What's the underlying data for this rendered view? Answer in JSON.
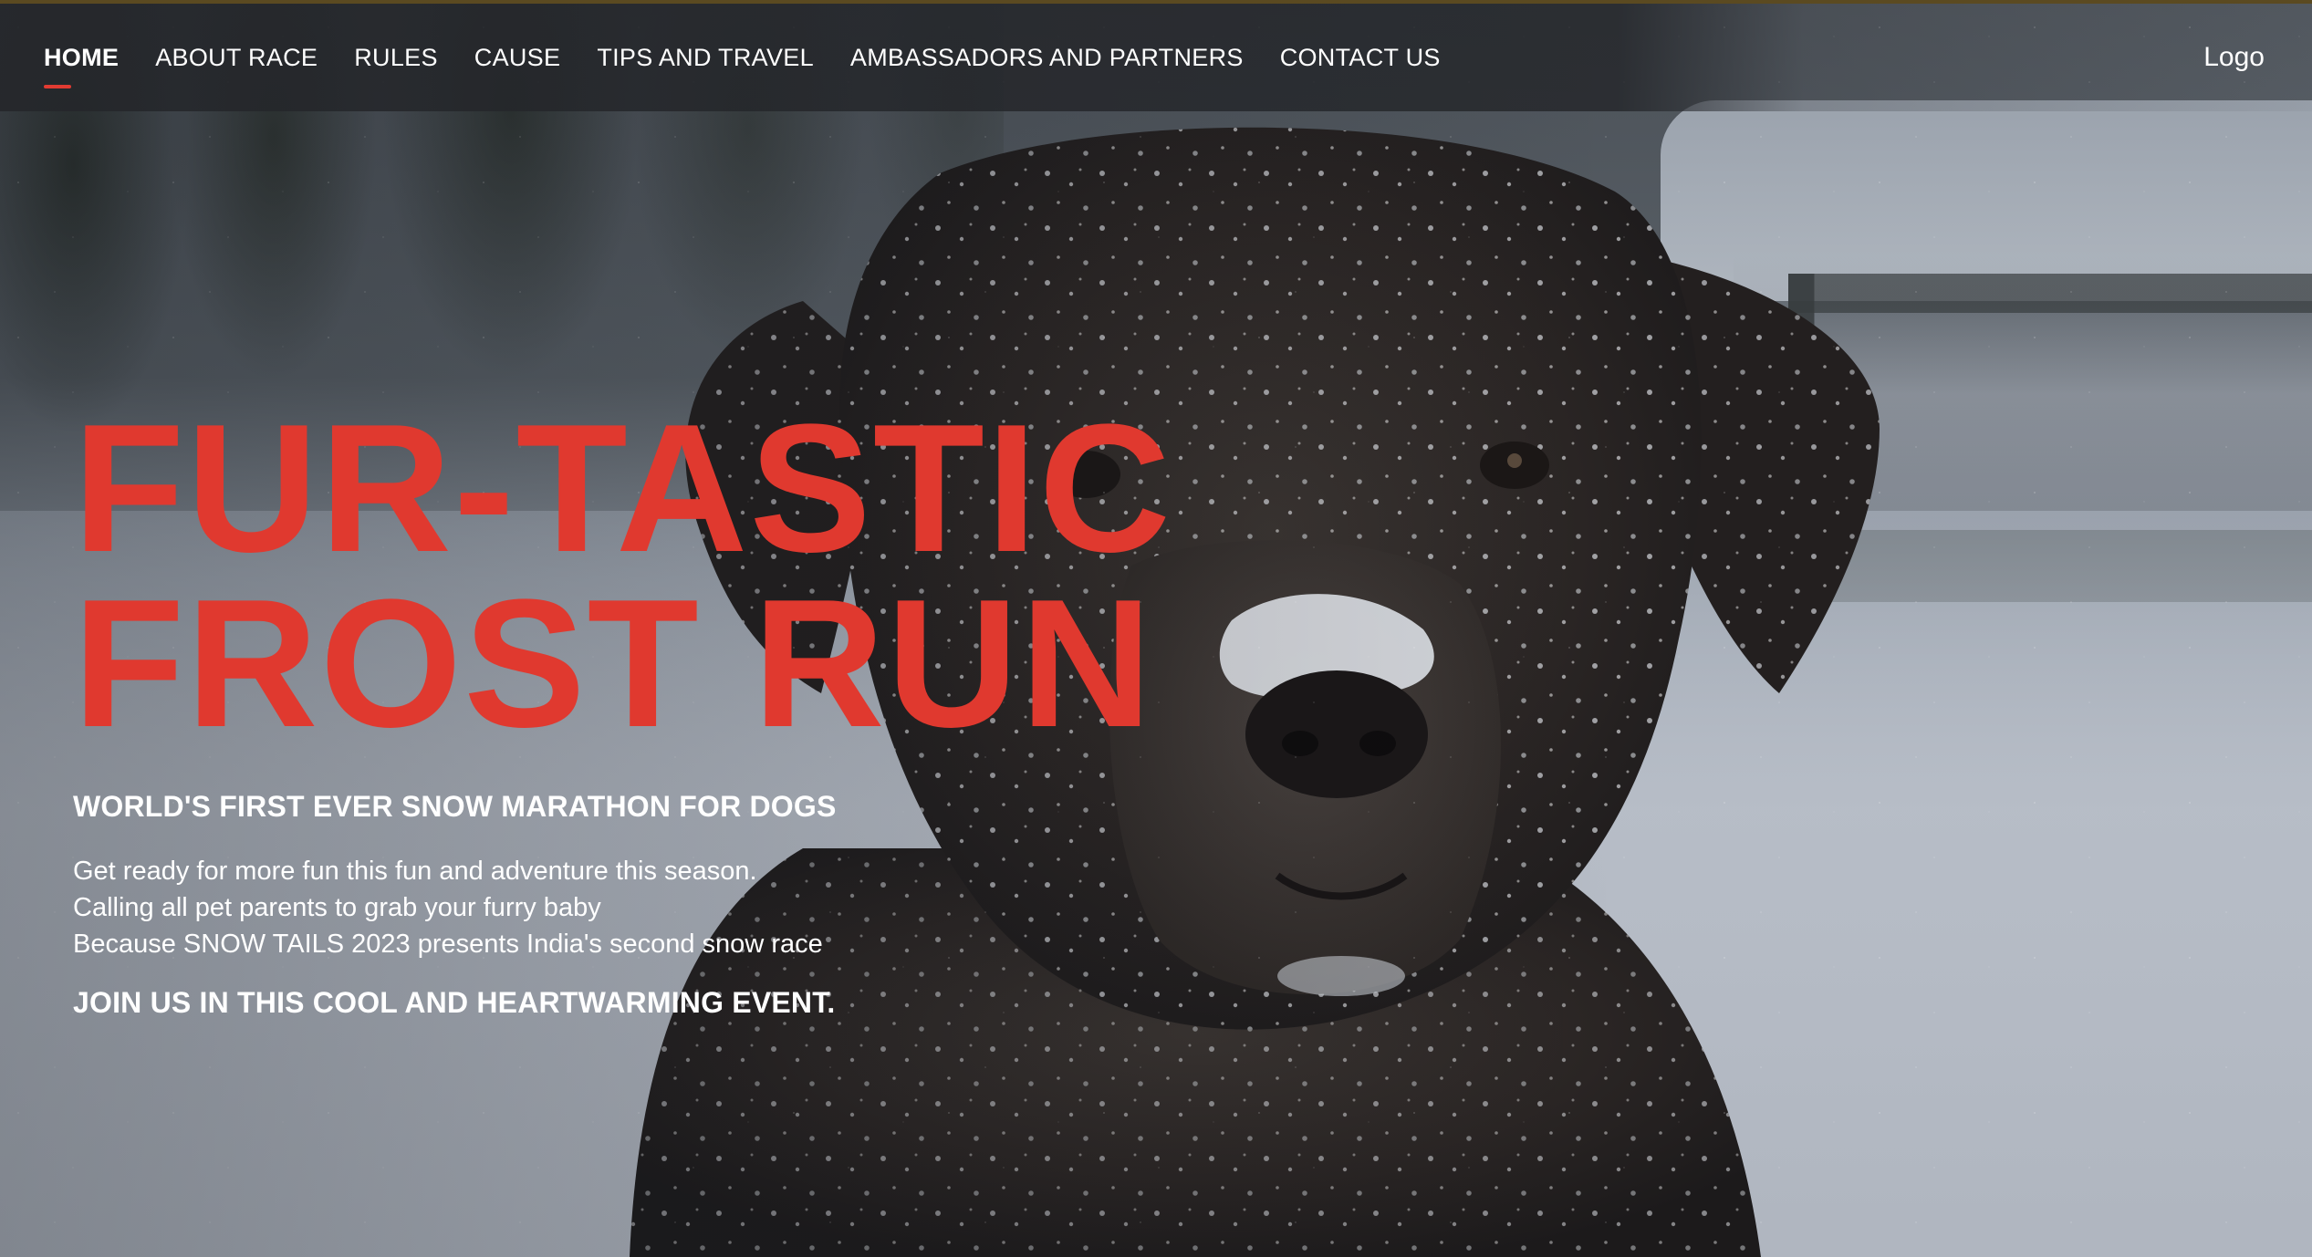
{
  "nav": {
    "items": [
      {
        "label": "HOME",
        "active": true
      },
      {
        "label": "ABOUT RACE",
        "active": false
      },
      {
        "label": "RULES",
        "active": false
      },
      {
        "label": "CAUSE",
        "active": false
      },
      {
        "label": "TIPS AND TRAVEL",
        "active": false
      },
      {
        "label": "AMBASSADORS AND PARTNERS",
        "active": false
      },
      {
        "label": "CONTACT US",
        "active": false
      }
    ],
    "logo": "Logo"
  },
  "hero": {
    "headline_line1": "FUR-TASTIC",
    "headline_line2": "FROST RUN",
    "subheading": "WORLD'S FIRST EVER SNOW MARATHON FOR DOGS",
    "description_lines": [
      "Get ready for more fun this fun and adventure this season.",
      "Calling all pet parents to grab your furry baby",
      "Because SNOW TAILS 2023 presents India's second snow race"
    ],
    "call_to_action": "JOIN US IN THIS COOL AND HEARTWARMING EVENT."
  },
  "colors": {
    "accent": "#e0392f",
    "nav_background": "#24262a",
    "text": "#ffffff"
  },
  "icons": {
    "hero_image": "snow-covered-dog-photo"
  }
}
